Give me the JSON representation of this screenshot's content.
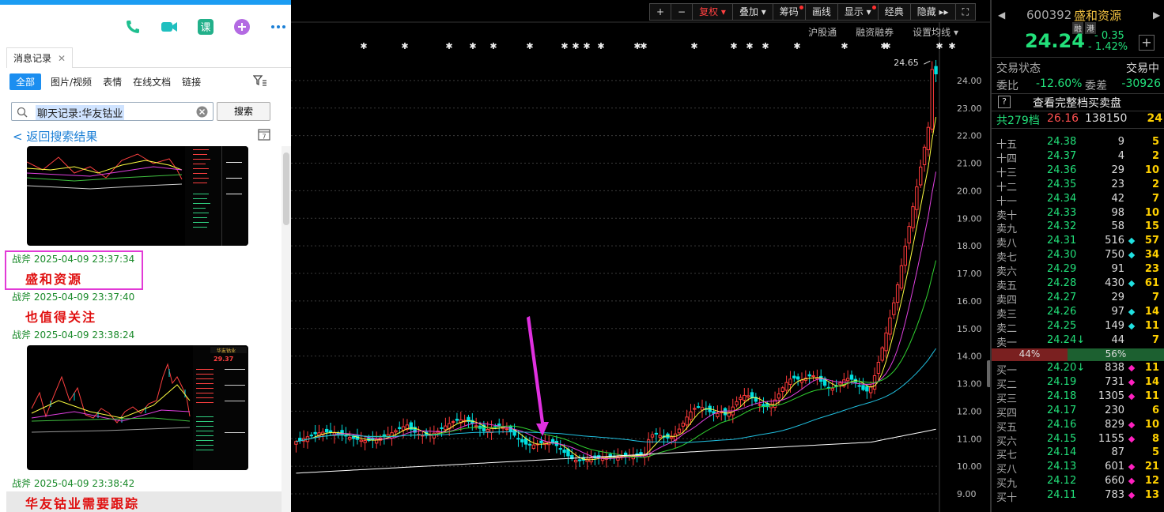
{
  "chat": {
    "tab_label": "消息记录",
    "filters": [
      "全部",
      "图片/视频",
      "表情",
      "在线文档",
      "链接"
    ],
    "search_value": "聊天记录:华友钴业",
    "search_button": "搜索",
    "back_label": "< 返回搜索结果",
    "calendar_day": "7",
    "messages": [
      {
        "meta": "战斧 2025-04-09 23:37:34",
        "text": "盛和资源"
      },
      {
        "meta": "战斧 2025-04-09 23:37:40",
        "text": "也值得关注"
      },
      {
        "meta": "战斧 2025-04-09 23:38:24",
        "text": ""
      },
      {
        "meta": "战斧 2025-04-09 23:38:42",
        "text": "华友钴业需要跟踪"
      }
    ],
    "thumb2_title": "华友钴业",
    "thumb2_price": "29.37"
  },
  "toolbar": {
    "buttons": [
      "+",
      "−",
      "复权",
      "叠加",
      "筹码",
      "画线",
      "显示",
      "经典",
      "隐藏"
    ],
    "sub": [
      "沪股通",
      "融资融券",
      "设置均线"
    ]
  },
  "chart_data": {
    "type": "candlestick",
    "y_ticks": [
      "24.00",
      "23.00",
      "22.00",
      "21.00",
      "20.00",
      "19.00",
      "18.00",
      "17.00",
      "16.00",
      "15.00",
      "14.00",
      "13.00",
      "12.00",
      "11.00",
      "10.00",
      "9.00"
    ],
    "ylim": [
      8.8,
      24.8
    ],
    "high_label": "24.65",
    "colors": {
      "up": "#ff3b3b",
      "down": "#00e0e0",
      "ma5": "#ffff40",
      "ma10": "#e040e0",
      "ma20": "#30d030",
      "ma60": "#20c0e0",
      "ma120": "#ffffff",
      "arrow": "#e030e0"
    }
  },
  "quote": {
    "code": "600392",
    "name": "盛和资源",
    "tags": [
      "融",
      "港"
    ],
    "price": "24.24",
    "change": "- 0.35",
    "pct": "- 1.42%",
    "status_label": "交易状态",
    "status_value": "交易中",
    "wb_label": "委比",
    "wb_value": "-12.60%",
    "wc_label": "委差",
    "wc_value": "-30926",
    "full_book": "查看完整档买卖盘",
    "total_label": "共279档",
    "total_price": "26.16",
    "total_vol": "138150",
    "total_cnt": "24",
    "ratio_sell": "44%",
    "ratio_buy": "56%",
    "sells": [
      {
        "lbl": "十五",
        "px": "24.38",
        "vol": "9",
        "cnt": "5",
        "dot": ""
      },
      {
        "lbl": "十四",
        "px": "24.37",
        "vol": "4",
        "cnt": "2",
        "dot": ""
      },
      {
        "lbl": "十三",
        "px": "24.36",
        "vol": "29",
        "cnt": "10",
        "dot": ""
      },
      {
        "lbl": "十二",
        "px": "24.35",
        "vol": "23",
        "cnt": "2",
        "dot": ""
      },
      {
        "lbl": "十一",
        "px": "24.34",
        "vol": "42",
        "cnt": "7",
        "dot": ""
      },
      {
        "lbl": "卖十",
        "px": "24.33",
        "vol": "98",
        "cnt": "10",
        "dot": ""
      },
      {
        "lbl": "卖九",
        "px": "24.32",
        "vol": "58",
        "cnt": "15",
        "dot": ""
      },
      {
        "lbl": "卖八",
        "px": "24.31",
        "vol": "516",
        "cnt": "57",
        "dot": "#20e0e0"
      },
      {
        "lbl": "卖七",
        "px": "24.30",
        "vol": "750",
        "cnt": "34",
        "dot": "#20e0e0"
      },
      {
        "lbl": "卖六",
        "px": "24.29",
        "vol": "91",
        "cnt": "23",
        "dot": ""
      },
      {
        "lbl": "卖五",
        "px": "24.28",
        "vol": "430",
        "cnt": "61",
        "dot": "#20e0e0"
      },
      {
        "lbl": "卖四",
        "px": "24.27",
        "vol": "29",
        "cnt": "7",
        "dot": ""
      },
      {
        "lbl": "卖三",
        "px": "24.26",
        "vol": "97",
        "cnt": "14",
        "dot": "#20e0e0"
      },
      {
        "lbl": "卖二",
        "px": "24.25",
        "vol": "149",
        "cnt": "11",
        "dot": "#20e0e0"
      },
      {
        "lbl": "卖一",
        "px": "24.24↓",
        "vol": "44",
        "cnt": "7",
        "dot": ""
      }
    ],
    "buys": [
      {
        "lbl": "买一",
        "px": "24.20↓",
        "vol": "838",
        "cnt": "11",
        "dot": "#ff20c0"
      },
      {
        "lbl": "买二",
        "px": "24.19",
        "vol": "731",
        "cnt": "14",
        "dot": "#ff20c0"
      },
      {
        "lbl": "买三",
        "px": "24.18",
        "vol": "1305",
        "cnt": "11",
        "dot": "#ff20c0"
      },
      {
        "lbl": "买四",
        "px": "24.17",
        "vol": "230",
        "cnt": "6",
        "dot": ""
      },
      {
        "lbl": "买五",
        "px": "24.16",
        "vol": "829",
        "cnt": "10",
        "dot": "#ff20c0"
      },
      {
        "lbl": "买六",
        "px": "24.15",
        "vol": "1155",
        "cnt": "8",
        "dot": "#ff20c0"
      },
      {
        "lbl": "买七",
        "px": "24.14",
        "vol": "87",
        "cnt": "5",
        "dot": ""
      },
      {
        "lbl": "买八",
        "px": "24.13",
        "vol": "601",
        "cnt": "21",
        "dot": "#ff20c0"
      },
      {
        "lbl": "买九",
        "px": "24.12",
        "vol": "660",
        "cnt": "12",
        "dot": "#ff20c0"
      },
      {
        "lbl": "买十",
        "px": "24.11",
        "vol": "783",
        "cnt": "13",
        "dot": "#ff20c0"
      }
    ]
  }
}
